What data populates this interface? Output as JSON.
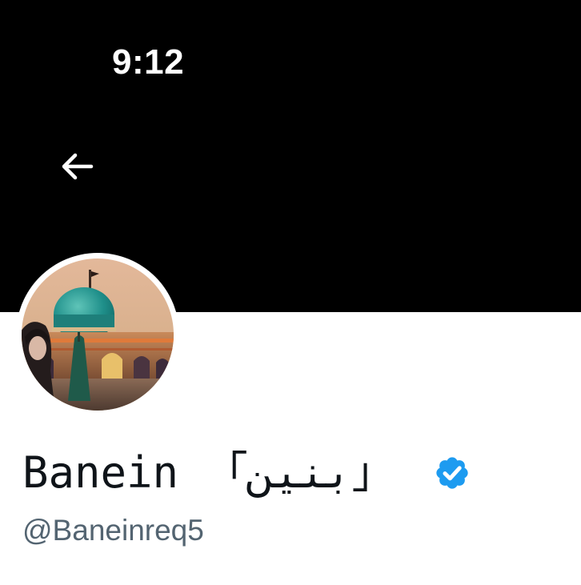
{
  "status_bar": {
    "time": "9:12"
  },
  "navigation": {
    "back_icon": "arrow-left-icon"
  },
  "profile": {
    "display_name": "Banein 「بنين」",
    "handle": "@Baneinreq5",
    "verified_icon": "verified-badge-icon",
    "verified_color": "#1d9bf0"
  },
  "colors": {
    "banner": "#000000",
    "text_primary": "#0f1419",
    "text_secondary": "#536471",
    "background": "#ffffff"
  }
}
